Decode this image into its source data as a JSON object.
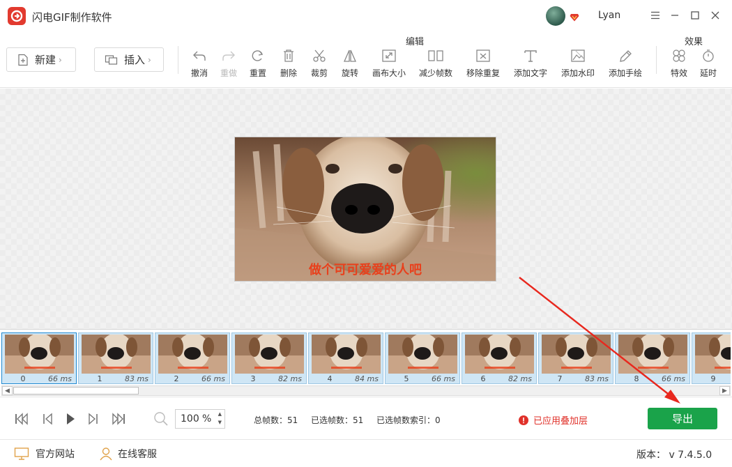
{
  "window": {
    "title": "闪电GIF制作软件",
    "username": "Lyan"
  },
  "toolbar": {
    "new_label": "新建",
    "insert_label": "插入",
    "edit_group_label": "编辑",
    "effects_group_label": "效果",
    "tools": {
      "undo": "撤消",
      "redo": "重做",
      "reset": "重置",
      "delete": "删除",
      "crop": "裁剪",
      "rotate": "旋转",
      "canvas_size": "画布大小",
      "reduce_frames": "减少帧数",
      "remove_duplicates": "移除重复",
      "add_text": "添加文字",
      "add_watermark": "添加水印",
      "add_drawing": "添加手绘",
      "effects": "特效",
      "delay": "延时"
    }
  },
  "preview": {
    "caption": "做个可可爱爱的人吧"
  },
  "frames": [
    {
      "index": "0",
      "duration": "66 ms"
    },
    {
      "index": "1",
      "duration": "83 ms"
    },
    {
      "index": "2",
      "duration": "66 ms"
    },
    {
      "index": "3",
      "duration": "82 ms"
    },
    {
      "index": "4",
      "duration": "84 ms"
    },
    {
      "index": "5",
      "duration": "66 ms"
    },
    {
      "index": "6",
      "duration": "82 ms"
    },
    {
      "index": "7",
      "duration": "83 ms"
    },
    {
      "index": "8",
      "duration": "66 ms"
    },
    {
      "index": "9",
      "duration": ""
    }
  ],
  "playback": {
    "zoom_value": "100",
    "zoom_unit": "%",
    "total_frames": "总帧数：51",
    "selected_frames": "已选帧数：51",
    "selected_index": "已选帧数索引：0",
    "overlay_notice": "已应用叠加层",
    "export_label": "导出"
  },
  "statusbar": {
    "website": "官方网站",
    "support": "在线客服",
    "version": "版本： v 7.4.5.0"
  },
  "colors": {
    "brand": "#e23a2f",
    "export": "#1aa34a",
    "warning": "#e0312a",
    "caption": "#e8401c",
    "frame_bg": "#cfe6f5"
  },
  "icons": {
    "logo": "app-logo-icon",
    "vip": "vip-diamond-icon",
    "menu": "hamburger-menu-icon",
    "minimize": "minimize-icon",
    "maximize": "maximize-icon",
    "close": "close-icon"
  }
}
